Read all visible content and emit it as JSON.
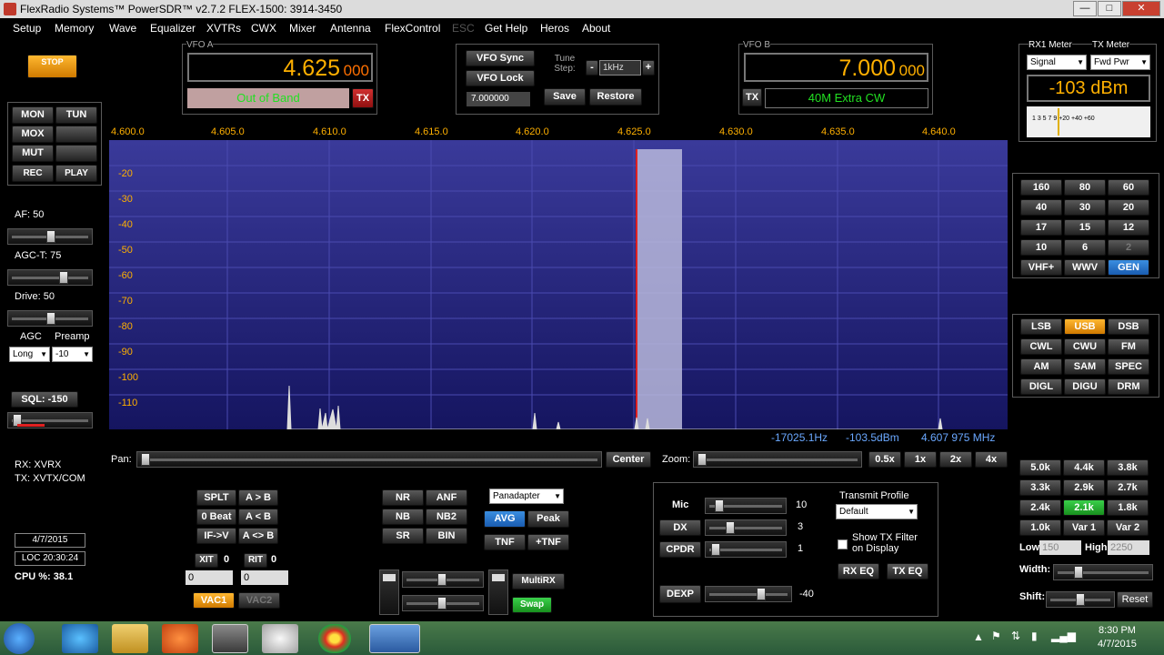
{
  "titlebar": {
    "title": "FlexRadio Systems™  PowerSDR™  v2.7.2   FLEX-1500: 3914-3450",
    "min": "—",
    "max": "□",
    "close": "✕"
  },
  "menu": [
    "Setup",
    "Memory",
    "Wave",
    "Equalizer",
    "XVTRs",
    "CWX",
    "Mixer",
    "Antenna",
    "FlexControl",
    "ESC",
    "Get Help",
    "Heros",
    "About"
  ],
  "left": {
    "stop": "STOP",
    "mon": "MON",
    "tun": "TUN",
    "mox": "MOX",
    "mut": "MUT",
    "rec": "REC",
    "play": "PLAY",
    "af": "AF:  50",
    "agct": "AGC-T:  75",
    "drive": "Drive:  50",
    "agc_label": "AGC",
    "preamp_label": "Preamp",
    "agc_value": "Long",
    "preamp_value": "-10",
    "sql": "SQL: -150",
    "rx": "RX: XVRX",
    "tx": "TX: XVTX/COM",
    "date": "4/7/2015",
    "loc": "LOC 20:30:24",
    "cpu": "CPU %: 38.1"
  },
  "vfoa": {
    "label": "VFO A",
    "freq": "4.625",
    "freq_sub": "000",
    "band": "Out of Band",
    "tx": "TX"
  },
  "mid": {
    "vfo_sync": "VFO Sync",
    "vfo_lock": "VFO Lock",
    "tune_step": "Tune Step:",
    "step_value": "1kHz",
    "minus": "-",
    "plus": "+",
    "freq": "7.000000",
    "save": "Save",
    "restore": "Restore"
  },
  "vfob": {
    "label": "VFO B",
    "freq": "7.000",
    "freq_sub": "000",
    "tx": "TX",
    "band": "40M Extra CW"
  },
  "meter": {
    "rx1": "RX1 Meter",
    "txm": "TX Meter",
    "rx_sel": "Signal",
    "tx_sel": "Fwd Pwr",
    "reading": "-103 dBm",
    "scale": "1  3  5  7  9    +20  +40  +60"
  },
  "pan": {
    "freqs": [
      "4.600.0",
      "4.605.0",
      "4.610.0",
      "4.615.0",
      "4.620.0",
      "4.625.0",
      "4.630.0",
      "4.635.0",
      "4.640.0"
    ],
    "dbs": [
      "-20",
      "-30",
      "-40",
      "-50",
      "-60",
      "-70",
      "-80",
      "-90",
      "-100",
      "-110"
    ],
    "cursor_hz": "-17025.1Hz",
    "cursor_dbm": "-103.5dBm",
    "cursor_mhz": "4.607 975 MHz"
  },
  "panbar": {
    "pan": "Pan:",
    "center": "Center",
    "zoom": "Zoom:",
    "z05": "0.5x",
    "z1": "1x",
    "z2": "2x",
    "z4": "4x"
  },
  "bands": [
    "160",
    "80",
    "60",
    "40",
    "30",
    "20",
    "17",
    "15",
    "12",
    "10",
    "6",
    "2",
    "VHF+",
    "WWV",
    "GEN"
  ],
  "modes": [
    "LSB",
    "USB",
    "DSB",
    "CWL",
    "CWU",
    "FM",
    "AM",
    "SAM",
    "SPEC",
    "DIGL",
    "DIGU",
    "DRM"
  ],
  "filters": [
    "5.0k",
    "4.4k",
    "3.8k",
    "3.3k",
    "2.9k",
    "2.7k",
    "2.4k",
    "2.1k",
    "1.8k",
    "1.0k",
    "Var 1",
    "Var 2"
  ],
  "filter_ctl": {
    "low": "Low",
    "low_val": "150",
    "high": "High",
    "high_val": "2250",
    "width": "Width:",
    "shift": "Shift:",
    "reset": "Reset"
  },
  "vfo_btns": {
    "splt": "SPLT",
    "atob": "A > B",
    "zbeat": "0 Beat",
    "atoa": "A < B",
    "ifv": "IF->V",
    "swap": "A <> B",
    "xit": "XIT",
    "xit_v": "0",
    "rit": "RIT",
    "rit_v": "0",
    "xit_in": "0",
    "rit_in": "0",
    "vac1": "VAC1",
    "vac2": "VAC2"
  },
  "dsp": {
    "nr": "NR",
    "anf": "ANF",
    "nb": "NB",
    "nb2": "NB2",
    "sr": "SR",
    "bin": "BIN",
    "display": "Panadapter",
    "avg": "AVG",
    "peak": "Peak",
    "tnf": "TNF",
    "ptnf": "+TNF",
    "multirx": "MultiRX",
    "swap": "Swap"
  },
  "tx": {
    "mic": "Mic",
    "mic_v": "10",
    "dx": "DX",
    "dx_v": "3",
    "cpdr": "CPDR",
    "cpdr_v": "1",
    "dexp": "DEXP",
    "dexp_v": "-40",
    "profile": "Transmit Profile",
    "profile_v": "Default",
    "show_tx": "Show TX Filter on Display",
    "rxeq": "RX EQ",
    "txeq": "TX EQ"
  },
  "tray": {
    "time": "8:30 PM",
    "date": "4/7/2015"
  }
}
